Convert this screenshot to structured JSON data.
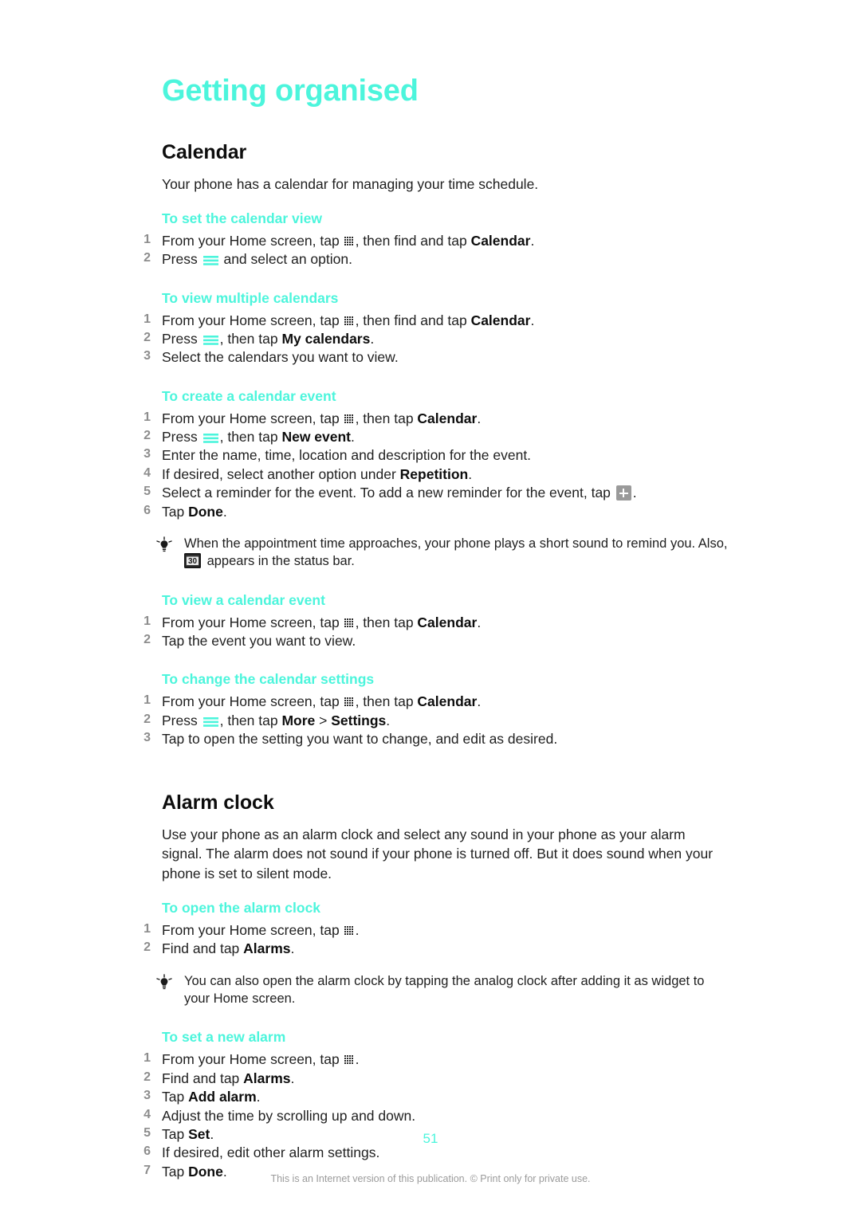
{
  "chapter": {
    "title": "Getting organised"
  },
  "sections": [
    {
      "id": "calendar",
      "title": "Calendar",
      "intro": "Your phone has a calendar for managing your time schedule."
    },
    {
      "id": "alarm-clock",
      "title": "Alarm clock",
      "intro": "Use your phone as an alarm clock and select any sound in your phone as your alarm signal. The alarm does not sound if your phone is turned off. But it does sound when your phone is set to silent mode."
    }
  ],
  "procedures": {
    "set_calendar_view": {
      "title": "To set the calendar view",
      "steps": [
        {
          "pre": "From your Home screen, tap ",
          "icon": "apps-grid-icon",
          "mid": ", then find and tap ",
          "bold": "Calendar",
          "post": "."
        },
        {
          "pre": "Press ",
          "icon": "menu-icon",
          "mid": " and select an option.",
          "bold": "",
          "post": ""
        }
      ]
    },
    "view_multiple_calendars": {
      "title": "To view multiple calendars",
      "steps": [
        {
          "pre": "From your Home screen, tap ",
          "icon": "apps-grid-icon",
          "mid": ", then find and tap ",
          "bold": "Calendar",
          "post": "."
        },
        {
          "pre": "Press ",
          "icon": "menu-icon",
          "mid": ", then tap ",
          "bold": "My calendars",
          "post": "."
        },
        {
          "pre": "Select the calendars you want to view.",
          "icon": "",
          "mid": "",
          "bold": "",
          "post": ""
        }
      ]
    },
    "create_calendar_event": {
      "title": "To create a calendar event",
      "steps": [
        {
          "pre": "From your Home screen, tap ",
          "icon": "apps-grid-icon",
          "mid": ", then tap ",
          "bold": "Calendar",
          "post": "."
        },
        {
          "pre": "Press ",
          "icon": "menu-icon",
          "mid": ", then tap ",
          "bold": "New event",
          "post": "."
        },
        {
          "pre": "Enter the name, time, location and description for the event.",
          "icon": "",
          "mid": "",
          "bold": "",
          "post": ""
        },
        {
          "pre": "If desired, select another option under ",
          "icon": "",
          "mid": "",
          "bold": "Repetition",
          "post": "."
        },
        {
          "pre": "Select a reminder for the event. To add a new reminder for the event, tap ",
          "icon": "plus-button-icon",
          "mid": ".",
          "bold": "",
          "post": ""
        },
        {
          "pre": "Tap ",
          "icon": "",
          "mid": "",
          "bold": "Done",
          "post": "."
        }
      ],
      "tip": {
        "pre": "When the appointment time approaches, your phone plays a short sound to remind you. Also, ",
        "icon": "calendar-badge-icon",
        "icon_label": "30",
        "post": " appears in the status bar."
      }
    },
    "view_calendar_event": {
      "title": "To view a calendar event",
      "steps": [
        {
          "pre": "From your Home screen, tap ",
          "icon": "apps-grid-icon",
          "mid": ", then tap ",
          "bold": "Calendar",
          "post": "."
        },
        {
          "pre": "Tap the event you want to view.",
          "icon": "",
          "mid": "",
          "bold": "",
          "post": ""
        }
      ]
    },
    "change_calendar_settings": {
      "title": "To change the calendar settings",
      "steps": [
        {
          "pre": "From your Home screen, tap ",
          "icon": "apps-grid-icon",
          "mid": ", then tap ",
          "bold": "Calendar",
          "post": "."
        },
        {
          "pre": "Press ",
          "icon": "menu-icon",
          "mid": ", then tap ",
          "bold": "More",
          "mid2": " > ",
          "bold2": "Settings",
          "post": "."
        },
        {
          "pre": "Tap to open the setting you want to change, and edit as desired.",
          "icon": "",
          "mid": "",
          "bold": "",
          "post": ""
        }
      ]
    },
    "open_alarm_clock": {
      "title": "To open the alarm clock",
      "steps": [
        {
          "pre": "From your Home screen, tap ",
          "icon": "apps-grid-icon",
          "mid": ".",
          "bold": "",
          "post": ""
        },
        {
          "pre": "Find and tap ",
          "icon": "",
          "mid": "",
          "bold": "Alarms",
          "post": "."
        }
      ],
      "tip": {
        "pre": "You can also open the alarm clock by tapping the analog clock after adding it as widget to your Home screen.",
        "icon": "",
        "icon_label": "",
        "post": ""
      }
    },
    "set_new_alarm": {
      "title": "To set a new alarm",
      "steps": [
        {
          "pre": "From your Home screen, tap ",
          "icon": "apps-grid-icon",
          "mid": ".",
          "bold": "",
          "post": ""
        },
        {
          "pre": "Find and tap ",
          "icon": "",
          "mid": "",
          "bold": "Alarms",
          "post": "."
        },
        {
          "pre": "Tap ",
          "icon": "",
          "mid": "",
          "bold": "Add alarm",
          "post": "."
        },
        {
          "pre": "Adjust the time by scrolling up and down.",
          "icon": "",
          "mid": "",
          "bold": "",
          "post": ""
        },
        {
          "pre": "Tap ",
          "icon": "",
          "mid": "",
          "bold": "Set",
          "post": "."
        },
        {
          "pre": "If desired, edit other alarm settings.",
          "icon": "",
          "mid": "",
          "bold": "",
          "post": ""
        },
        {
          "pre": "Tap ",
          "icon": "",
          "mid": "",
          "bold": "Done",
          "post": "."
        }
      ]
    }
  },
  "footer": {
    "page_number": "51",
    "note": "This is an Internet version of this publication. © Print only for private use."
  },
  "colors": {
    "accent": "#4cf5dc",
    "body_text": "#1f1f1f",
    "step_number": "#8d8d8d",
    "footer_note": "#9b9b9b",
    "plus_button": "#9a9a9a"
  }
}
